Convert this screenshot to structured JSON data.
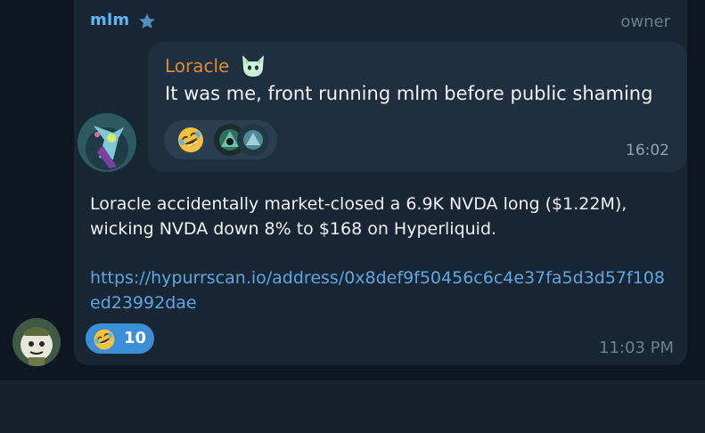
{
  "message": {
    "sender": "mlm",
    "role": "owner",
    "reply": {
      "author": "Loracle",
      "text": "It was me, front running mlm before public shaming",
      "time": "16:02",
      "reaction_emoji": "rolling-on-floor-laughing-icon"
    },
    "body_line1": "Loracle accidentally market-closed a 6.9K NVDA long ($1.22M),",
    "body_line2": "wicking NVDA down 8% to $168 on Hyperliquid.",
    "link": "https://hypurrscan.io/address/0x8def9f50456c6c4e37fa5d3d57f108ed23992dae",
    "reaction": {
      "emoji": "rolling-on-floor-laughing-icon",
      "count": "10"
    },
    "time": "11:03 PM"
  },
  "colors": {
    "background": "#0e1621",
    "bubble": "#182533",
    "sender": "#5eb5f7",
    "reply_author": "#d98b3a",
    "link": "#5ba7e3",
    "reaction": "#3a8fd6"
  }
}
